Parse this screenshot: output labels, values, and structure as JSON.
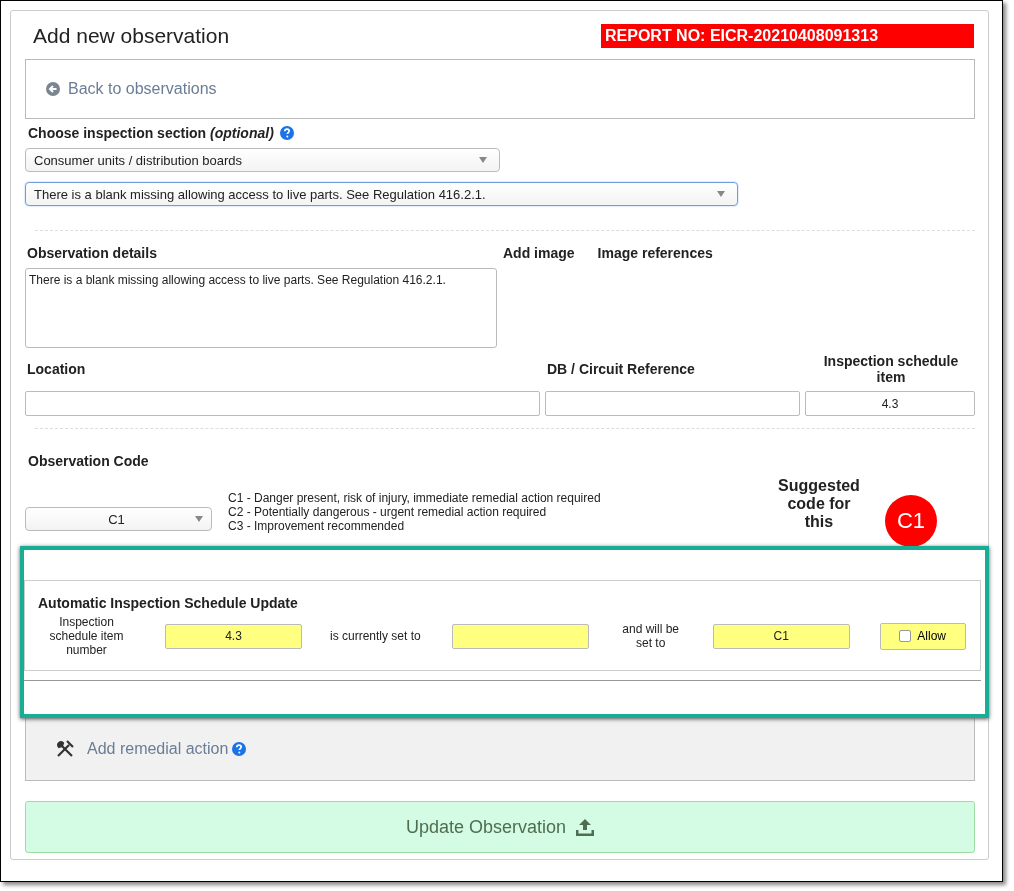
{
  "title": "Add new observation",
  "report_badge": "REPORT NO: EICR-20210408091313",
  "back_link": "Back to observations",
  "section_label": "Choose inspection section *(optional)*",
  "section_select": "Consumer units / distribution boards",
  "observation_select": "There is a blank missing allowing access to live parts. See Regulation 416.2.1.",
  "details": {
    "label": "Observation details",
    "value": "There is a blank missing allowing access to live parts. See Regulation 416.2.1."
  },
  "add_image_label": "Add image",
  "image_references_label": "Image references",
  "location": {
    "label": "Location"
  },
  "circuit_reference": {
    "label": "DB / Circuit Reference"
  },
  "schedule_item": {
    "label": "Inspection schedule item",
    "value": "4.3"
  },
  "observation_code": {
    "label": "Observation Code",
    "value": "C1",
    "legend": [
      "C1 - Danger present, risk of injury, immediate remedial action required",
      "C2 - Potentially dangerous - urgent remedial action required",
      "C3 - Improvement recommended"
    ],
    "suggested_label": "Suggested code for this",
    "suggested_code": "C1"
  },
  "schedule_update": {
    "title": "Automatic Inspection Schedule Update",
    "item_label": "Inspection schedule item number",
    "item_value": "4.3",
    "current_label": "is currently set to",
    "new_label": "and will be set to",
    "new_value": "C1",
    "allow": {
      "label": "Allow",
      "checked": false
    }
  },
  "remedial_link": "Add remedial action",
  "submit": "Update Observation"
}
